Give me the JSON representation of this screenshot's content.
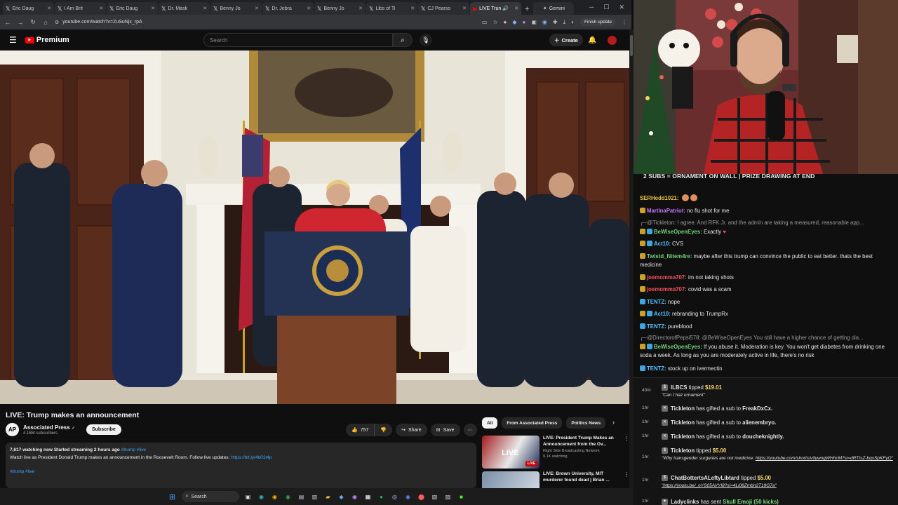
{
  "browser": {
    "tabs": [
      {
        "label": "Eric Daug"
      },
      {
        "label": "I Am Brit"
      },
      {
        "label": "Eric Daug"
      },
      {
        "label": "Dr. Mask"
      },
      {
        "label": "Benny Jo"
      },
      {
        "label": "Dr. Jebra"
      },
      {
        "label": "Benny Jo"
      },
      {
        "label": "Libs of Ti"
      },
      {
        "label": "CJ Pearso"
      },
      {
        "label": "LIVE Trun"
      }
    ],
    "gemini_tab": "Gemini",
    "url": "youtube.com/watch?v=ZuSuNjx_rpA",
    "finish_update": "Finish update"
  },
  "yt": {
    "logo_text": "Premium",
    "search_placeholder": "Search",
    "create_label": "Create",
    "video_title": "LIVE: Trump makes an announcement",
    "channel_name": "Associated Press",
    "channel_subs": "4.16M subscribers",
    "channel_logo": "AP",
    "subscribe_label": "Subscribe",
    "like_count": "757",
    "share_label": "Share",
    "save_label": "Save",
    "desc_stats": "7,617 watching now  Started streaming 2 hours ago",
    "desc_tags": "#trump #live",
    "desc_text": "Watch live as President Donald Trump makes an announcement in the Roosevelt Room. Follow live updates:",
    "desc_link": "https://bit.ly/4b01t4p",
    "desc_tags2": "#trump #live",
    "chips": [
      "All",
      "From Associated Press",
      "Politics News"
    ],
    "recs": [
      {
        "title": "LIVE: President Trump Makes an Announcement from the Ov...",
        "channel": "Right Side Broadcasting Network",
        "meta": "9.1K watching",
        "badge": "LIVE"
      },
      {
        "title": "LIVE: Brown University, MIT murderer found dead | Brian ...",
        "channel": "",
        "meta": "",
        "badge": ""
      }
    ]
  },
  "taskbar": {
    "search": "Search"
  },
  "chat": {
    "banner": "2 SUBS = ORNAMENT ON WALL | PRIZE DRAWING AT END",
    "messages": [
      {
        "user": "SERHedd1021:",
        "text": ""
      },
      {
        "user": "MartinaPatriot:",
        "text": "no flu shot for me"
      },
      {
        "reply": "@Tickleton: I agree. And RFK Jr. and the admin are taking a measured, reasonable app..."
      },
      {
        "user": "BeWiseOpenEyes:",
        "text": "Exactly"
      },
      {
        "user": "Act10:",
        "text": "CVS"
      },
      {
        "user": "Twistd_Nitem4re:",
        "text": "maybe after this trump can convince the public to eat better. thats the best medicine"
      },
      {
        "user": "joemomma707:",
        "text": "im not taking shots"
      },
      {
        "user": "joemomma707:",
        "text": "covid was a scam"
      },
      {
        "user": "TENTZ:",
        "text": "nope"
      },
      {
        "user": "Act10:",
        "text": "rebranding to TrumpRx"
      },
      {
        "user": "TENTZ:",
        "text": "pureblood"
      },
      {
        "reply": "@DirectorofPepsi578: @BeWiseOpenEyes You still have a higher chance of getting dia..."
      },
      {
        "user": "BeWiseOpenEyes:",
        "text": "If you abuse it. Moderation is key. You won't get diabetes from drinking one soda a week. As long as you are moderately active in life, there's no risk"
      },
      {
        "user": "TENTZ:",
        "text": "stock up on ivermectin"
      }
    ]
  },
  "events": [
    {
      "time": "40m",
      "user": "ILBCS",
      "action": "tipped",
      "amount": "$19.01",
      "note": "\"Can I haz ornament\""
    },
    {
      "time": "1hr",
      "user": "Tickleton",
      "action": "has gifted a sub to",
      "target": "FreakDxCx."
    },
    {
      "time": "1hr",
      "user": "Tickleton",
      "action": "has gifted a sub to",
      "target": "alienembryo."
    },
    {
      "time": "1hr",
      "user": "Tickleton",
      "action": "has gifted a sub to",
      "target": "doucheknightly."
    },
    {
      "time": "1hr",
      "user": "Tickleton",
      "action": "tipped",
      "amount": "$5.00",
      "note": "\"Why transgender surgeries are not medicine:",
      "link": "https://youtube.com/shorts/v9ywogWHhcM?si=dRTIsZ-bqxSpKFyO\""
    },
    {
      "time": "1hr",
      "user": "ChatBottertsALeftyLibtard",
      "action": "tipped",
      "amount": "$5.00",
      "link": "\"https://youtu.be/_oYS05AVYI8?si=4Li08Zmbn2T19G7a\""
    },
    {
      "time": "1hr",
      "user": "Ladyclinks",
      "action": "has sent",
      "gift": "Skull Emoji (50 kicks)"
    }
  ]
}
